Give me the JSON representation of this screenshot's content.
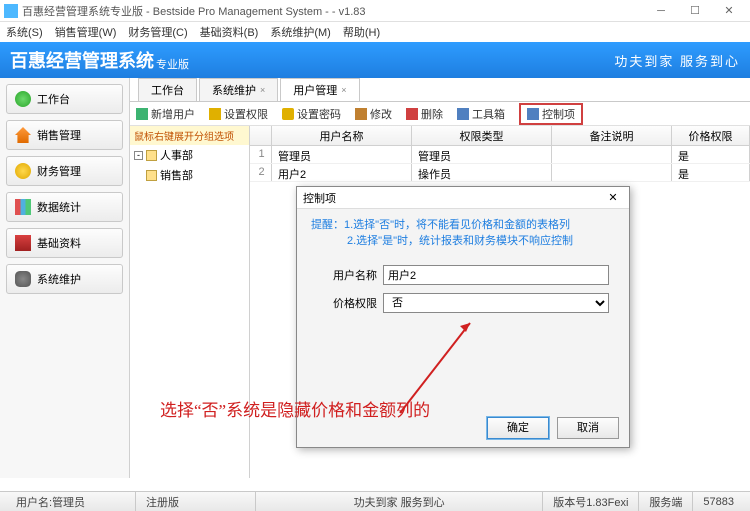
{
  "window": {
    "title": "百惠经营管理系统专业版 - Bestside Pro Management System - - v1.83"
  },
  "menu": [
    "系统(S)",
    "销售管理(W)",
    "财务管理(C)",
    "基础资料(B)",
    "系统维护(M)",
    "帮助(H)"
  ],
  "banner": {
    "title": "百惠经营管理系统",
    "sub": "专业版",
    "right": "功夫到家 服务到心"
  },
  "sidebar": [
    {
      "label": "工作台"
    },
    {
      "label": "销售管理"
    },
    {
      "label": "财务管理"
    },
    {
      "label": "数据统计"
    },
    {
      "label": "基础资料"
    },
    {
      "label": "系统维护"
    }
  ],
  "tabs": [
    {
      "label": "工作台"
    },
    {
      "label": "系统维护"
    },
    {
      "label": "用户管理",
      "active": true,
      "closable": true
    }
  ],
  "toolbar": [
    {
      "label": "新增用户"
    },
    {
      "label": "设置权限"
    },
    {
      "label": "设置密码"
    },
    {
      "label": "修改"
    },
    {
      "label": "删除"
    },
    {
      "label": "工具箱"
    },
    {
      "label": "控制项",
      "hl": true
    }
  ],
  "tree": {
    "header": "鼠标右键展开分组选项",
    "root": "人事部",
    "items": [
      "销售部"
    ]
  },
  "grid": {
    "headers": [
      "",
      "用户名称",
      "权限类型",
      "备注说明",
      "价格权限"
    ],
    "rows": [
      [
        "1",
        "管理员",
        "管理员",
        "",
        "是"
      ],
      [
        "2",
        "用户2",
        "操作员",
        "",
        "是"
      ]
    ]
  },
  "dialog": {
    "title": "控制项",
    "hint1": "提醒：1.选择\"否\"时，将不能看见价格和金额的表格列",
    "hint2": "2.选择\"是\"时，统计报表和财务模块不响应控制",
    "user_label": "用户名称",
    "user_value": "用户2",
    "perm_label": "价格权限",
    "perm_value": "否",
    "ok": "确定",
    "cancel": "取消"
  },
  "annotation": "选择“否”系统是隐藏价格和金额列的",
  "status": {
    "user_label": "用户名:",
    "user": "管理员",
    "reg": "注册版",
    "motto": "功夫到家 服务到心",
    "ver": "版本号1.83Fexi",
    "srv": "服务端",
    "port": "57883"
  }
}
